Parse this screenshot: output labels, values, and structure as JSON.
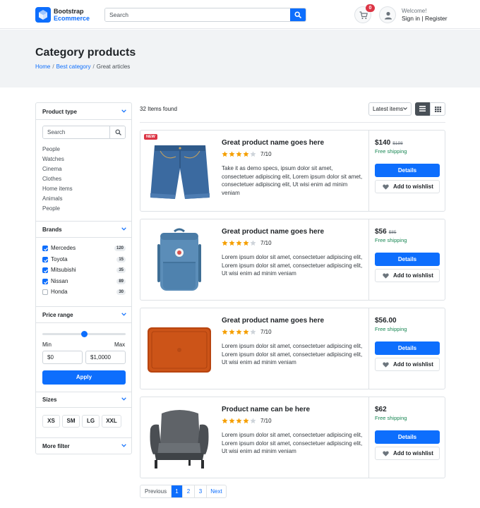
{
  "header": {
    "brand_line1": "Bootstrap",
    "brand_line2": "Ecommerce",
    "search_placeholder": "Search",
    "cart_count": "0",
    "welcome": "Welcome!",
    "sign_in": "Sign in",
    "register": "Register",
    "separator": "|"
  },
  "hero": {
    "title": "Category products",
    "breadcrumb": [
      "Home",
      "Best category",
      "Great articles"
    ],
    "breadcrumb_sep": "/"
  },
  "sidebar": {
    "product_type": {
      "title": "Product type",
      "search_placeholder": "Search",
      "items": [
        "People",
        "Watches",
        "Cinema",
        "Clothes",
        "Home items",
        "Animals",
        "People"
      ]
    },
    "brands": {
      "title": "Brands",
      "items": [
        {
          "label": "Mercedes",
          "count": "120",
          "checked": true
        },
        {
          "label": "Toyota",
          "count": "15",
          "checked": true
        },
        {
          "label": "Mitsubishi",
          "count": "35",
          "checked": true
        },
        {
          "label": "Nissan",
          "count": "89",
          "checked": true
        },
        {
          "label": "Honda",
          "count": "30",
          "checked": false
        }
      ]
    },
    "price_range": {
      "title": "Price range",
      "slider_fraction": 0.5,
      "min_label": "Min",
      "max_label": "Max",
      "min_value": "$0",
      "max_value": "$1,0000",
      "apply_label": "Apply"
    },
    "sizes": {
      "title": "Sizes",
      "items": [
        "XS",
        "SM",
        "LG",
        "XXL"
      ]
    },
    "more_filter": {
      "title": "More filter"
    }
  },
  "toolbar": {
    "found": "32 Items found",
    "sort_selected": "Latest items",
    "view_mode": "list"
  },
  "products": [
    {
      "name": "Great product name goes here",
      "badge": "NEW",
      "stars": 4,
      "rating": "7/10",
      "description": "Take it as demo specs, ipsum dolor sit amet, consectetuer adipiscing elit, Lorem ipsum dolor sit amet, consectetuer adipiscing elit, Ut wisi enim ad minim veniam",
      "price": "$140",
      "old_price": "$198",
      "shipping": "Free shipping",
      "details_label": "Details",
      "wishlist_label": "Add to wishlist",
      "image": "denim-shorts"
    },
    {
      "name": "Great product name goes here",
      "stars": 4,
      "rating": "7/10",
      "description": "Lorem ipsum dolor sit amet, consectetuer adipiscing elit, Lorem ipsum dolor sit amet, consectetuer adipiscing elit, Ut wisi enim ad minim veniam",
      "price": "$56",
      "old_price": "$85",
      "shipping": "Free shipping",
      "details_label": "Details",
      "wishlist_label": "Add to wishlist",
      "image": "blue-backpack"
    },
    {
      "name": "Great product name goes here",
      "stars": 4,
      "rating": "7/10",
      "description": "Lorem ipsum dolor sit amet, consectetuer adipiscing elit, Lorem ipsum dolor sit amet, consectetuer adipiscing elit, Ut wisi enim ad minim veniam",
      "price": "$56.00",
      "shipping": "Free shipping",
      "details_label": "Details",
      "wishlist_label": "Add to wishlist",
      "image": "orange-laptop-sleeve"
    },
    {
      "name": "Product name can be here",
      "stars": 4,
      "rating": "7/10",
      "description": "Lorem ipsum dolor sit amet, consectetuer adipiscing elit, Lorem ipsum dolor sit amet, consectetuer adipiscing elit, Ut wisi enim ad minim veniam",
      "price": "$62",
      "shipping": "Free shipping",
      "details_label": "Details",
      "wishlist_label": "Add to wishlist",
      "image": "grey-armchair"
    }
  ],
  "pagination": {
    "previous": "Previous",
    "pages": [
      "1",
      "2",
      "3"
    ],
    "active_page": "1",
    "next": "Next"
  },
  "colors": {
    "primary": "#0d6efd",
    "badge_red": "#dc3545",
    "star": "#f59f00",
    "shipping_green": "#198754"
  }
}
